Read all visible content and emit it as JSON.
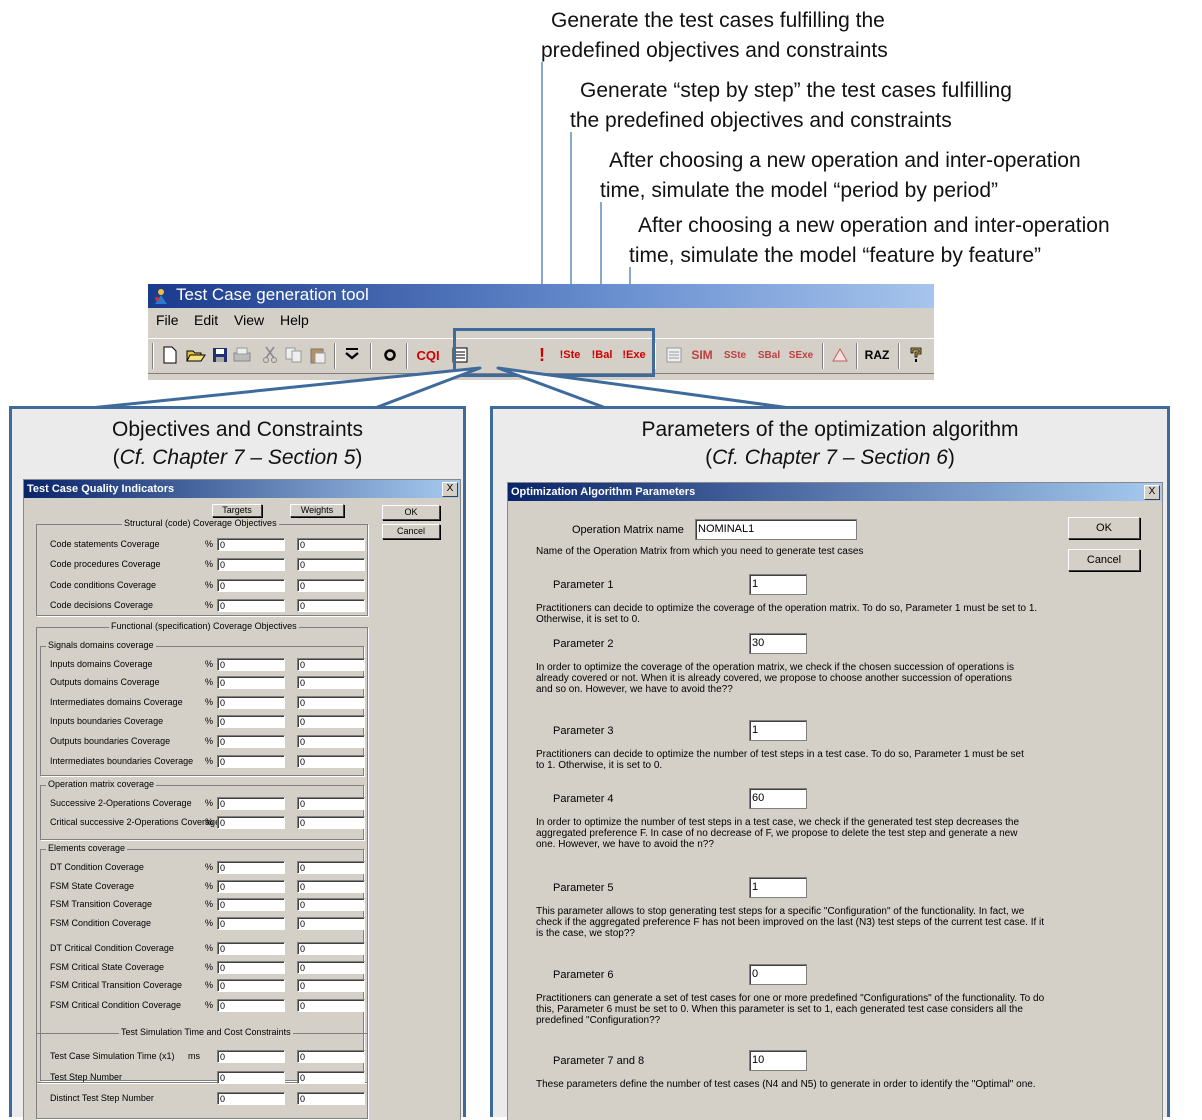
{
  "annotations": [
    {
      "line1": "Generate the test cases fulfilling the",
      "line2": "predefined objectives and constraints"
    },
    {
      "line1": "Generate “step by step” the test cases fulfilling",
      "line2": "the predefined objectives and constraints"
    },
    {
      "line1": "After choosing a new operation and inter-operation",
      "line2": "time, simulate the model “period by period”"
    },
    {
      "line1": "After choosing a new operation and inter-operation",
      "line2": "time, simulate the model “feature by feature”"
    }
  ],
  "window": {
    "title": "Test Case generation tool",
    "menu": [
      "File",
      "Edit",
      "View",
      "Help"
    ],
    "toolbar": [
      "new-icon",
      "open-icon",
      "save-icon",
      "print-icon",
      "cut-icon",
      "copy-icon",
      "paste-icon",
      "down-arrow-icon",
      "settings-icon",
      "cqi-icon",
      "list-icon",
      "exclaim-icon",
      "ste-icon",
      "bal-icon",
      "exe-icon",
      "list2-icon",
      "sim-icon",
      "sste-icon",
      "sbal-icon",
      "sexe-icon",
      "warning-icon",
      "raz-icon",
      "help-icon"
    ],
    "toolbar_labels": {
      "cqi": "CQI",
      "ste": "Ste",
      "bal": "Bal",
      "exe": "Exe",
      "sim": "SIM",
      "sste": "Ste",
      "sbal": "Bal",
      "sexe": "Exe",
      "raz": "RAZ",
      "bang": "!"
    }
  },
  "left_panel": {
    "heading": "Objectives and Constraints",
    "ref_pre": "(",
    "ref_italic": "Cf. Chapter 7 – Section 5",
    "ref_post": ")",
    "dialog": {
      "title": "Test Case Quality Indicators",
      "close": "X",
      "col_targets": "Targets",
      "col_weights": "Weights",
      "ok": "OK",
      "cancel": "Cancel",
      "group_structural": "Structural (code) Coverage Objectives",
      "structural": [
        {
          "label": "Code statements Coverage",
          "unit": "%",
          "target": "0",
          "weight": "0"
        },
        {
          "label": "Code procedures Coverage",
          "unit": "%",
          "target": "0",
          "weight": "0"
        },
        {
          "label": "Code conditions Coverage",
          "unit": "%",
          "target": "0",
          "weight": "0"
        },
        {
          "label": "Code decisions Coverage",
          "unit": "%",
          "target": "0",
          "weight": "0"
        }
      ],
      "group_functional": "Functional (specification) Coverage Objectives",
      "group_signals": "Signals domains coverage",
      "signals": [
        {
          "label": "Inputs domains Coverage",
          "unit": "%",
          "target": "0",
          "weight": "0"
        },
        {
          "label": "Outputs domains Coverage",
          "unit": "%",
          "target": "0",
          "weight": "0"
        },
        {
          "label": "Intermediates domains Coverage",
          "unit": "%",
          "target": "0",
          "weight": "0"
        },
        {
          "label": "Inputs boundaries Coverage",
          "unit": "%",
          "target": "0",
          "weight": "0"
        },
        {
          "label": "Outputs boundaries Coverage",
          "unit": "%",
          "target": "0",
          "weight": "0"
        },
        {
          "label": "Intermediates boundaries Coverage",
          "unit": "%",
          "target": "0",
          "weight": "0"
        }
      ],
      "group_opmatrix": "Operation matrix coverage",
      "opmatrix": [
        {
          "label": "Successive 2-Operations Coverage",
          "unit": "%",
          "target": "0",
          "weight": "0"
        },
        {
          "label": "Critical successive 2-Operations Coverage",
          "unit": "%",
          "target": "0",
          "weight": "0"
        }
      ],
      "group_elements": "Elements coverage",
      "elements": [
        {
          "label": "DT Condition Coverage",
          "unit": "%",
          "target": "0",
          "weight": "0"
        },
        {
          "label": "FSM State Coverage",
          "unit": "%",
          "target": "0",
          "weight": "0"
        },
        {
          "label": "FSM Transition Coverage",
          "unit": "%",
          "target": "0",
          "weight": "0"
        },
        {
          "label": "FSM Condition Coverage",
          "unit": "%",
          "target": "0",
          "weight": "0"
        },
        {
          "label": "DT Critical Condition Coverage",
          "unit": "%",
          "target": "0",
          "weight": "0"
        },
        {
          "label": "FSM Critical State Coverage",
          "unit": "%",
          "target": "0",
          "weight": "0"
        },
        {
          "label": "FSM Critical Transition Coverage",
          "unit": "%",
          "target": "0",
          "weight": "0"
        },
        {
          "label": "FSM Critical Condition Coverage",
          "unit": "%",
          "target": "0",
          "weight": "0"
        }
      ],
      "group_time": "Test Simulation Time and Cost Constraints",
      "time": [
        {
          "label": "Test Case Simulation Time (x1)",
          "unit": "ms",
          "target": "0",
          "weight": "0"
        },
        {
          "label": "Test Step Number",
          "unit": "",
          "target": "0",
          "weight": "0"
        },
        {
          "label": "Distinct Test Step Number",
          "unit": "",
          "target": "0",
          "weight": "0"
        }
      ]
    }
  },
  "right_panel": {
    "heading": "Parameters of the optimization algorithm",
    "ref_pre": "(",
    "ref_italic": "Cf. Chapter 7 – Section 6",
    "ref_post": ")",
    "dialog": {
      "title": "Optimization Algorithm Parameters",
      "close": "X",
      "ok": "OK",
      "cancel": "Cancel",
      "matrix_label": "Operation Matrix name",
      "matrix_value": "NOMINAL1",
      "matrix_desc": "Name of the Operation Matrix from which you need to generate test cases",
      "params": [
        {
          "label": "Parameter 1",
          "value": "1",
          "desc": [
            "Practitioners can decide to optimize the coverage of the operation matrix. To do so, Parameter 1 must be set to 1.",
            "Otherwise, it is set to 0."
          ]
        },
        {
          "label": "Parameter 2",
          "value": "30",
          "desc": [
            "In order to optimize the coverage of the operation matrix, we check if the chosen succession of operations is",
            "already covered or not. When it is already covered, we propose to choose another succession of operations",
            "and so on. However, we have to avoid the??"
          ]
        },
        {
          "label": "Parameter 3",
          "value": "1",
          "desc": [
            "Practitioners can decide to optimize the number of test steps in a test case. To do so, Parameter 1 must be set",
            "to 1. Otherwise, it is set to 0."
          ]
        },
        {
          "label": "Parameter 4",
          "value": "60",
          "desc": [
            "In order to optimize the number of test steps in a test case, we check if the generated test step decreases the",
            "aggregated preference F. In case of no decrease of F, we propose to delete the test step and generate a new",
            "one. However, we have to avoid the n??"
          ]
        },
        {
          "label": "Parameter 5",
          "value": "1",
          "desc": [
            "This parameter allows to stop generating test steps for a specific \"Configuration\" of the functionality. In fact, we",
            "check if the aggregated preference F has not been improved on the last (N3) test steps of the current test case. If it",
            "is the case, we stop??"
          ]
        },
        {
          "label": "Parameter 6",
          "value": "0",
          "desc": [
            "Practitioners can generate a set of test cases for one or more predefined \"Configurations\" of the functionality. To do",
            "this, Parameter 6 must be set to 0. When this parameter is set to 1, each generated test case considers all the",
            "predefined \"Configuration??"
          ]
        },
        {
          "label": "Parameter 7 and 8",
          "value": "10",
          "desc": [
            "These parameters define the number of test cases (N4 and N5) to generate in order to identify the \"Optimal\" one."
          ]
        }
      ]
    }
  },
  "colors": {
    "callout": "#3e6a9c",
    "titlebar": "#1a3a8c",
    "dialog_bg": "#d4d0c8"
  }
}
